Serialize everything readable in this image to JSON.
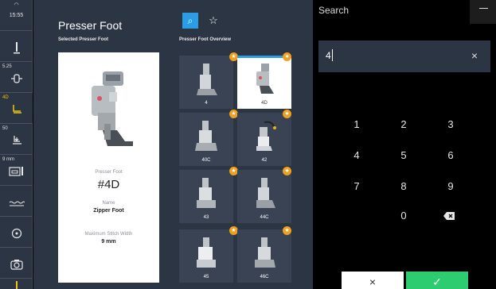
{
  "status": {
    "wifi_icon": "wifi-icon",
    "time": "15:55"
  },
  "sidebar": {
    "items": [
      {
        "value": "",
        "icon": "needle-icon",
        "glyph": "🪡"
      },
      {
        "value": "5.25",
        "icon": "stitch-width-icon",
        "glyph": "⇹"
      },
      {
        "value": "4D",
        "icon": "presser-foot-icon",
        "glyph": "⅃"
      },
      {
        "value": "50",
        "icon": "presser-foot-pressure-icon",
        "glyph": "⩡"
      },
      {
        "value": "9 mm",
        "icon": "stitch-plate-icon",
        "glyph": "▭"
      },
      {
        "value": "",
        "icon": "bobbin-thread-icon",
        "glyph": "≈"
      },
      {
        "value": "",
        "icon": "target-icon",
        "glyph": "◎"
      },
      {
        "value": "",
        "icon": "camera-icon",
        "glyph": "◙"
      },
      {
        "value": "",
        "icon": "thread-icon",
        "glyph": "ǃ"
      }
    ]
  },
  "main": {
    "title": "Presser Foot",
    "selected_heading": "Selected Presser Foot",
    "overview_heading": "Presser Foot Overview",
    "detail": {
      "foot_label": "Presser Foot",
      "foot_number": "#4D",
      "name_label": "Name",
      "name_value": "Zipper Foot",
      "width_label": "Maximum Stitch Width",
      "width_value": "9 mm"
    },
    "tabs": [
      {
        "icon": "search-icon",
        "glyph": "⌕"
      },
      {
        "icon": "star-icon",
        "glyph": "☆"
      }
    ],
    "tiles": [
      {
        "label": "4",
        "selected": false
      },
      {
        "label": "4D",
        "selected": true
      },
      {
        "label": "40C",
        "selected": false
      },
      {
        "label": "42",
        "selected": false
      },
      {
        "label": "43",
        "selected": false
      },
      {
        "label": "44C",
        "selected": false
      },
      {
        "label": "45",
        "selected": false
      },
      {
        "label": "46C",
        "selected": false
      }
    ]
  },
  "search": {
    "title": "Search",
    "input_value": "4",
    "keys": [
      "1",
      "2",
      "3",
      "4",
      "5",
      "6",
      "7",
      "8",
      "9",
      "0"
    ],
    "cancel_glyph": "×",
    "confirm_glyph": "✓"
  },
  "colors": {
    "accent_blue": "#2b9ce6",
    "confirm_green": "#2ecc71",
    "favorite_orange": "#f0a020",
    "active_yellow": "#f1c40f"
  }
}
